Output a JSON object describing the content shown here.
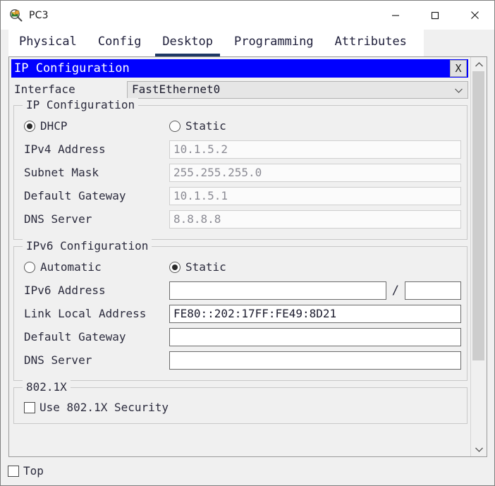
{
  "window": {
    "title": "PC3",
    "icon": "packet-tracer-pc-icon",
    "controls": {
      "minimize": "–",
      "maximize": "□",
      "close": "×"
    }
  },
  "tabs": [
    {
      "label": "Physical",
      "active": false
    },
    {
      "label": "Config",
      "active": false
    },
    {
      "label": "Desktop",
      "active": true
    },
    {
      "label": "Programming",
      "active": false
    },
    {
      "label": "Attributes",
      "active": false
    }
  ],
  "ip_config_panel": {
    "header_title": "IP Configuration",
    "close_label": "X",
    "interface": {
      "label": "Interface",
      "value": "FastEthernet0"
    },
    "ipv4": {
      "group_title": "IP Configuration",
      "mode_dhcp": {
        "label": "DHCP",
        "selected": true
      },
      "mode_static": {
        "label": "Static",
        "selected": false
      },
      "fields": [
        {
          "label": "IPv4 Address",
          "value": "10.1.5.2",
          "enabled": false
        },
        {
          "label": "Subnet Mask",
          "value": "255.255.255.0",
          "enabled": false
        },
        {
          "label": "Default Gateway",
          "value": "10.1.5.1",
          "enabled": false
        },
        {
          "label": "DNS Server",
          "value": "8.8.8.8",
          "enabled": false
        }
      ]
    },
    "ipv6": {
      "group_title": "IPv6 Configuration",
      "mode_automatic": {
        "label": "Automatic",
        "selected": false
      },
      "mode_static": {
        "label": "Static",
        "selected": true
      },
      "address": {
        "label": "IPv6 Address",
        "value": "",
        "prefix": "",
        "separator": "/"
      },
      "link_local": {
        "label": "Link Local Address",
        "value": "FE80::202:17FF:FE49:8D21"
      },
      "gateway": {
        "label": "Default Gateway",
        "value": ""
      },
      "dns": {
        "label": "DNS Server",
        "value": ""
      }
    },
    "dot1x": {
      "group_title": "802.1X",
      "use_security": {
        "label": "Use 802.1X Security",
        "checked": false
      }
    }
  },
  "bottom": {
    "top_checkbox": {
      "label": "Top",
      "checked": false
    }
  },
  "scrollbar": {
    "up_arrow": "⌃",
    "down_arrow": "⌄"
  },
  "colors": {
    "header_blue": "#0000FF",
    "header_text": "#FFFFFF",
    "tab_active_underline": "#1F3864",
    "window_bg": "#F0F0F0",
    "disabled_text": "#8B8B94"
  }
}
